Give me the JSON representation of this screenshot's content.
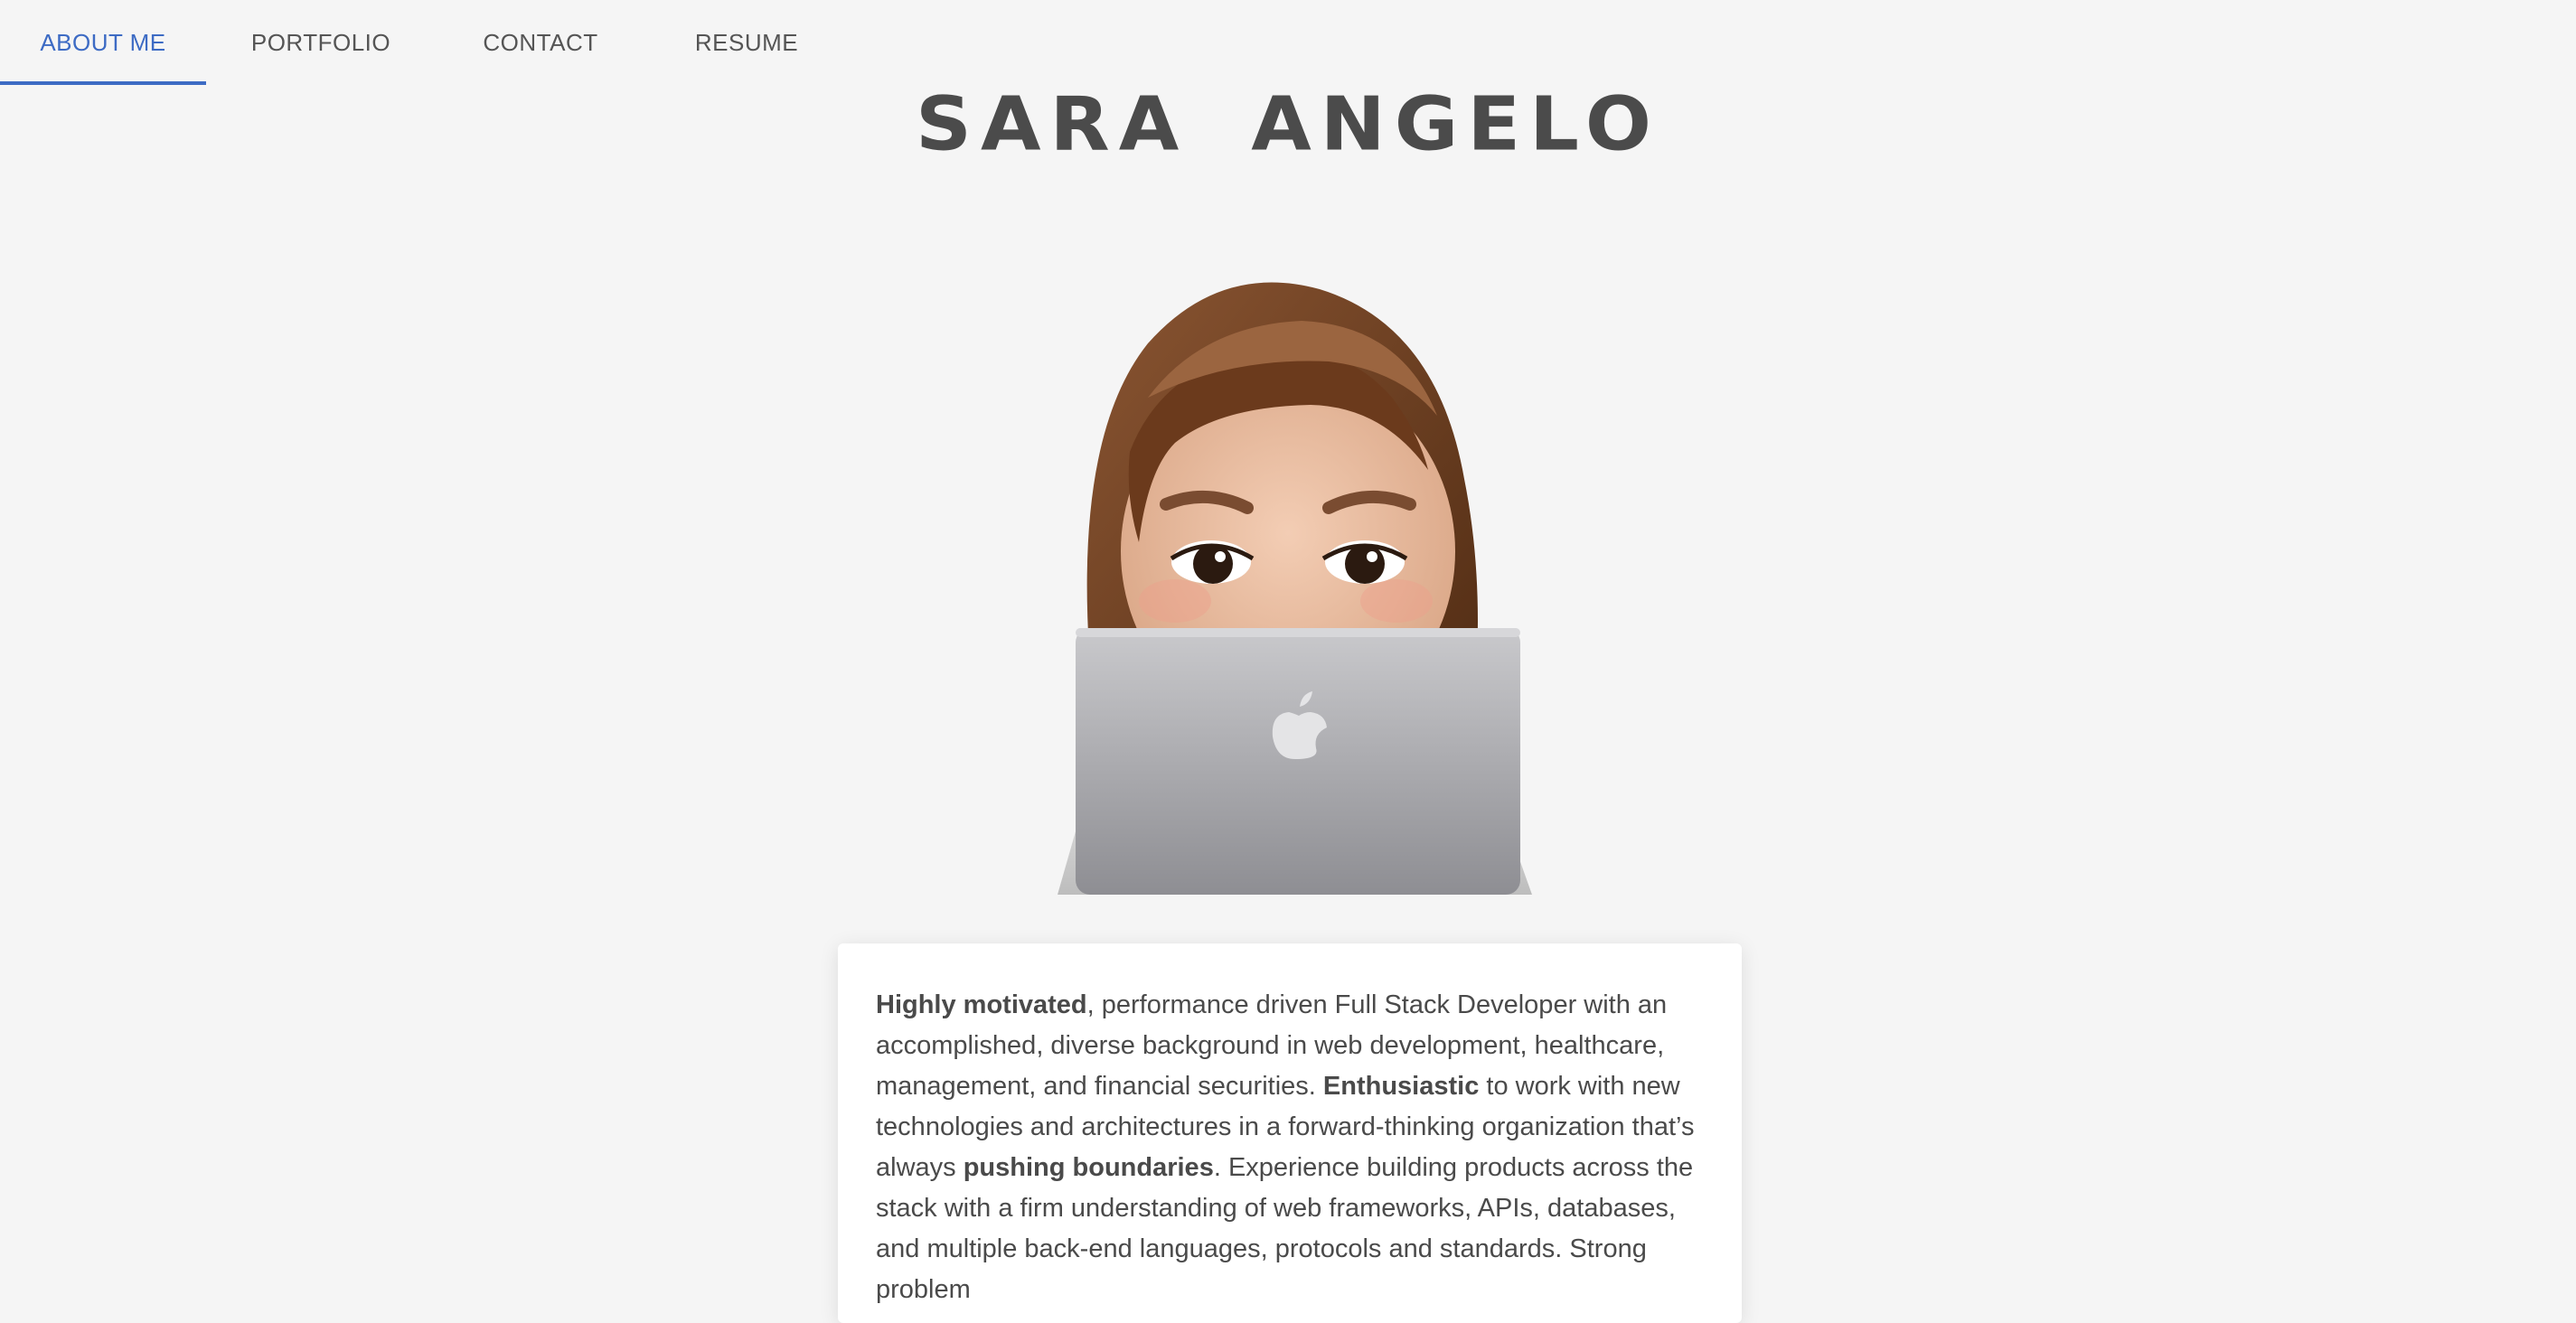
{
  "nav": {
    "items": [
      {
        "label": "ABOUT ME",
        "active": true
      },
      {
        "label": "PORTFOLIO",
        "active": false
      },
      {
        "label": "CONTACT",
        "active": false
      },
      {
        "label": "RESUME",
        "active": false
      }
    ]
  },
  "header": {
    "title": "SARA ANGELO"
  },
  "avatar": {
    "icon": "memoji-avatar-laptop-icon"
  },
  "bio": {
    "segments": [
      {
        "text": "Highly motivated",
        "bold": true
      },
      {
        "text": ", performance driven Full Stack Developer with an accomplished, diverse background in web development, healthcare, management, and financial securities. ",
        "bold": false
      },
      {
        "text": "Enthusiastic",
        "bold": true
      },
      {
        "text": " to work with new technologies and architectures in a forward-thinking organization that’s always ",
        "bold": false
      },
      {
        "text": "pushing boundaries",
        "bold": true
      },
      {
        "text": ". Experience building products across the stack with a firm understanding of web frameworks, APIs, databases, and multiple back-end languages, protocols and standards. Strong problem",
        "bold": false
      }
    ]
  },
  "colors": {
    "accent": "#3d6bc4",
    "nav_text": "#555555",
    "title": "#4b4b4b",
    "background": "#f5f5f5",
    "card": "#ffffff"
  }
}
